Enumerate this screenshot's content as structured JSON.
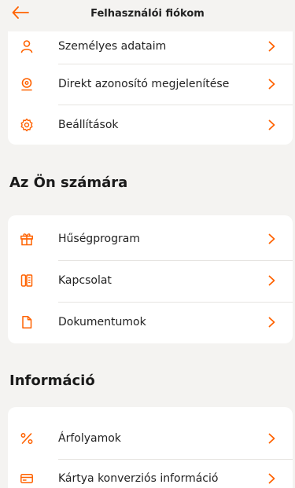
{
  "header": {
    "title": "Felhasználói fiókom",
    "back_icon": "arrow-left-icon"
  },
  "accent_color": "#ff6200",
  "account_card": {
    "items": [
      {
        "label": "Személyes adataim",
        "icon": "person-icon"
      },
      {
        "label": "Direkt azonosító megjelenítése",
        "icon": "id-badge-icon"
      },
      {
        "label": "Beállítások",
        "icon": "gear-icon"
      }
    ]
  },
  "for_you": {
    "title": "Az Ön számára",
    "items": [
      {
        "label": "Hűségprogram",
        "icon": "gift-icon"
      },
      {
        "label": "Kapcsolat",
        "icon": "phone-book-icon"
      },
      {
        "label": "Dokumentumok",
        "icon": "document-icon"
      }
    ]
  },
  "information": {
    "title": "Információ",
    "items": [
      {
        "label": "Árfolyamok",
        "icon": "percent-icon"
      },
      {
        "label": "Kártya konverziós információ",
        "icon": "card-icon"
      }
    ]
  }
}
